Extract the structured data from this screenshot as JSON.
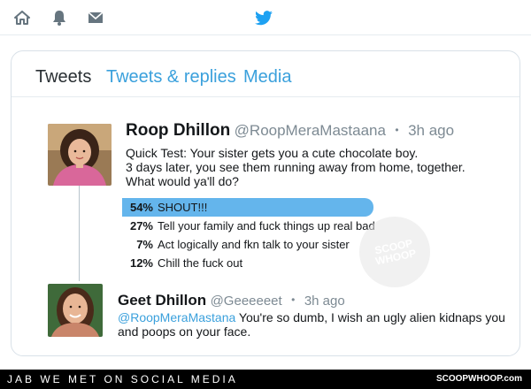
{
  "nav": {
    "icons": [
      "home-icon",
      "bell-icon",
      "mail-icon",
      "twitter-bird-icon"
    ],
    "accent": "#1da1f2"
  },
  "tabs": [
    {
      "label": "Tweets",
      "active": true
    },
    {
      "label": "Tweets & replies",
      "active": false
    },
    {
      "label": "Media",
      "active": false
    }
  ],
  "tweet": {
    "name": "Roop Dhillon",
    "handle": "@RoopMeraMastaana",
    "separator": "•",
    "time": "3h ago",
    "lines": [
      "Quick Test: Your sister gets you a cute chocolate boy.",
      "3 days later, you see them running away from home, together.",
      "What would ya'll do?"
    ],
    "poll": [
      {
        "percent": "54%",
        "value": 54,
        "label": "SHOUT!!!"
      },
      {
        "percent": "27%",
        "value": 27,
        "label": "Tell your family and fuck things up real bad"
      },
      {
        "percent": "7%",
        "value": 7,
        "label": "Act logically and fkn talk to your sister"
      },
      {
        "percent": "12%",
        "value": 12,
        "label": "Chill the fuck out"
      }
    ]
  },
  "reply": {
    "name": "Geet Dhillon",
    "handle": "@Geeeeeet",
    "separator": "•",
    "time": "3h ago",
    "mention": "@RoopMeraMastana",
    "text": " You're so dumb, I wish an ugly alien kidnaps you and poops on your face."
  },
  "watermark": "SCOOP WHOOP",
  "footer": {
    "left": "JAB WE MET ON SOCIAL MEDIA",
    "right": "SCOOPWHOOP.com"
  },
  "colors": {
    "link": "#3aa0dc",
    "poll_fill": "#64b5ec",
    "muted": "#7d8a93"
  }
}
